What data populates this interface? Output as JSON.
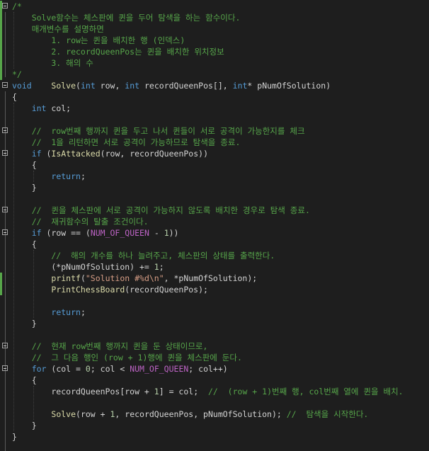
{
  "editor": {
    "lines": [
      {
        "text": "/*",
        "cls": "c",
        "fold": true
      },
      {
        "text": "    Solve함수는 체스판에 퀸을 두어 탐색을 하는 함수이다.",
        "cls": "c",
        "fold": false
      },
      {
        "text": "    매개변수를 설명하면",
        "cls": "c",
        "fold": false
      },
      {
        "text": "        1. row는 퀸을 배치한 행 (인덱스)",
        "cls": "c",
        "fold": false
      },
      {
        "text": "        2. recordQueenPos는 퀸을 배치한 위치정보",
        "cls": "c",
        "fold": false
      },
      {
        "text": "        3. 해의 수",
        "cls": "c",
        "fold": false
      },
      {
        "text": "*/",
        "cls": "c",
        "fold": false
      },
      {
        "text": "void    Solve(int row, int recordQueenPos[], int* pNumOfSolution)",
        "cls": "plain",
        "fold": true
      },
      {
        "text": "{",
        "cls": "plain",
        "fold": false
      },
      {
        "text": "    int col;",
        "cls": "plain",
        "fold": false
      },
      {
        "text": "",
        "cls": "plain",
        "fold": false
      },
      {
        "text": "    //  row번째 행까지 퀸을 두고 나서 퀸들이 서로 공격이 가능한지를 체크",
        "cls": "c",
        "fold": true
      },
      {
        "text": "    //  1을 리턴하면 서로 공격이 가능하므로 탐색을 종료.",
        "cls": "c",
        "fold": false
      },
      {
        "text": "    if (IsAttacked(row, recordQueenPos))",
        "cls": "plain",
        "fold": true
      },
      {
        "text": "    {",
        "cls": "plain",
        "fold": false
      },
      {
        "text": "        return;",
        "cls": "plain",
        "fold": false
      },
      {
        "text": "    }",
        "cls": "plain",
        "fold": false
      },
      {
        "text": "",
        "cls": "plain",
        "fold": false
      },
      {
        "text": "    //  퀸을 체스판에 서로 공격이 가능하지 않도록 배치한 경우로 탐색 종료.",
        "cls": "c",
        "fold": true
      },
      {
        "text": "    //  재귀함수의 탈출 조건이다.",
        "cls": "c",
        "fold": false
      },
      {
        "text": "    if (row == (NUM_OF_QUEEN - 1))",
        "cls": "plain",
        "fold": true
      },
      {
        "text": "    {",
        "cls": "plain",
        "fold": false
      },
      {
        "text": "        //  해의 개수를 하나 늘려주고, 체스판의 상태를 출력한다.",
        "cls": "c",
        "fold": false
      },
      {
        "text": "        (*pNumOfSolution) += 1;",
        "cls": "plain",
        "fold": false
      },
      {
        "text": "        printf(\"Solution #%d\\n\", *pNumOfSolution);",
        "cls": "plain",
        "fold": false
      },
      {
        "text": "        PrintChessBoard(recordQueenPos);",
        "cls": "plain",
        "fold": false
      },
      {
        "text": "",
        "cls": "plain",
        "fold": false
      },
      {
        "text": "        return;",
        "cls": "plain",
        "fold": false
      },
      {
        "text": "    }",
        "cls": "plain",
        "fold": false
      },
      {
        "text": "",
        "cls": "plain",
        "fold": false
      },
      {
        "text": "    //  현재 row번째 행까지 퀸을 둔 상태이므로,",
        "cls": "c",
        "fold": true
      },
      {
        "text": "    //  그 다음 행인 (row + 1)행에 퀸을 체스판에 둔다.",
        "cls": "c",
        "fold": false
      },
      {
        "text": "    for (col = 0; col < NUM_OF_QUEEN; col++)",
        "cls": "plain",
        "fold": true
      },
      {
        "text": "    {",
        "cls": "plain",
        "fold": false
      },
      {
        "text": "        recordQueenPos[row + 1] = col;  //  (row + 1)번째 행, col번째 열에 퀸을 배치.",
        "cls": "plain",
        "fold": false
      },
      {
        "text": "",
        "cls": "plain",
        "fold": false
      },
      {
        "text": "        Solve(row + 1, recordQueenPos, pNumOfSolution); //  탐색을 시작한다.",
        "cls": "plain",
        "fold": false
      },
      {
        "text": "    }",
        "cls": "plain",
        "fold": false
      },
      {
        "text": "}",
        "cls": "plain",
        "fold": false
      }
    ]
  },
  "colors": {
    "background": "#1e1e1e",
    "comment": "#57a64a",
    "keyword": "#569cd6",
    "string": "#d69d85",
    "macro": "#bd63c5",
    "function": "#dcdcaa",
    "number": "#b5cea8",
    "text": "#d4d4d4"
  }
}
